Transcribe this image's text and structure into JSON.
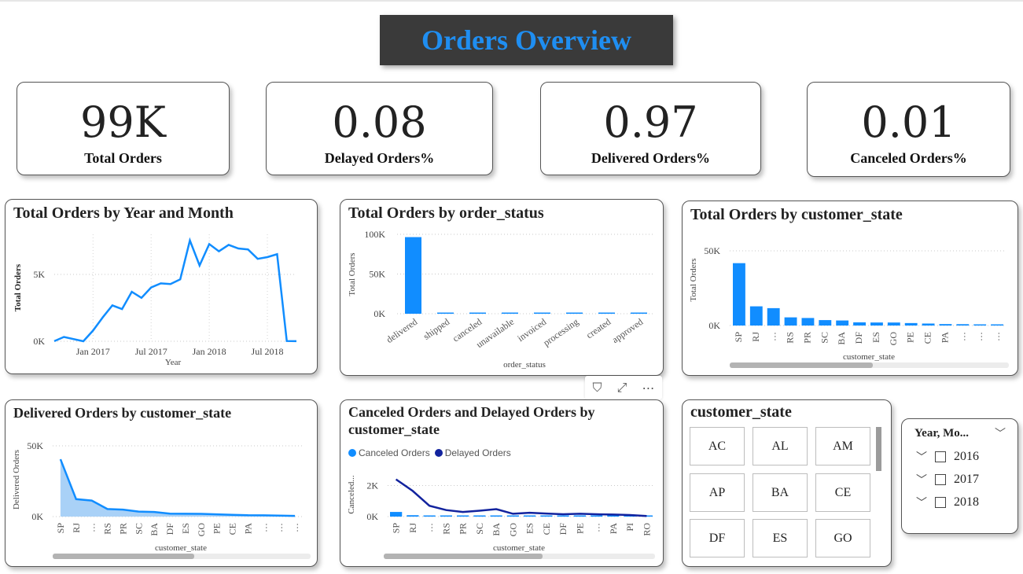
{
  "page": {
    "title": "Orders Overview"
  },
  "kpis": [
    {
      "value": "99K",
      "label": "Total Orders"
    },
    {
      "value": "0.08",
      "label": "Delayed Orders%"
    },
    {
      "value": "0.97",
      "label": "Delivered Orders%"
    },
    {
      "value": "0.01",
      "label": "Canceled Orders%"
    }
  ],
  "colors": {
    "accent": "#118dff",
    "dark_series": "#12239e",
    "area_fill": "#a9d1f7",
    "title_bg": "#3a3a3a"
  },
  "toolbar": {
    "filter_icon": "filter-icon",
    "focus_icon": "focus-mode-icon",
    "more_icon": "more-options-icon"
  },
  "chart_data": [
    {
      "type": "line",
      "title": "Total Orders by Year and Month",
      "xlabel": "Year",
      "ylabel": "Total Orders",
      "x_ticks": [
        "Jan 2017",
        "Jul 2017",
        "Jan 2018",
        "Jul 2018"
      ],
      "y_ticks": [
        "0K",
        "5K"
      ],
      "ylim": [
        0,
        8000
      ],
      "x": [
        "2016-09",
        "2016-10",
        "2016-12",
        "2017-01",
        "2017-02",
        "2017-03",
        "2017-04",
        "2017-05",
        "2017-06",
        "2017-07",
        "2017-08",
        "2017-09",
        "2017-10",
        "2017-11",
        "2017-12",
        "2018-01",
        "2018-02",
        "2018-03",
        "2018-04",
        "2018-05",
        "2018-06",
        "2018-07",
        "2018-08",
        "2018-09",
        "2018-10"
      ],
      "values": [
        4,
        324,
        1,
        800,
        1780,
        2682,
        2404,
        3700,
        3245,
        4026,
        4331,
        4285,
        4631,
        7544,
        5673,
        7269,
        6728,
        7211,
        6939,
        6873,
        6167,
        6292,
        6512,
        16,
        4
      ]
    },
    {
      "type": "bar",
      "title": "Total Orders by order_status",
      "xlabel": "order_status",
      "ylabel": "Total Orders",
      "y_ticks": [
        "0K",
        "50K",
        "100K"
      ],
      "ylim": [
        0,
        100000
      ],
      "categories": [
        "delivered",
        "shipped",
        "canceled",
        "unavailable",
        "invoiced",
        "processing",
        "created",
        "approved"
      ],
      "values": [
        96478,
        1107,
        625,
        609,
        314,
        301,
        5,
        2
      ]
    },
    {
      "type": "bar",
      "title": "Total Orders by customer_state",
      "xlabel": "customer_state",
      "ylabel": "Total Orders",
      "y_ticks": [
        "0K",
        "50K"
      ],
      "ylim": [
        0,
        50000
      ],
      "categories": [
        "SP",
        "RJ",
        "…",
        "RS",
        "PR",
        "SC",
        "BA",
        "DF",
        "ES",
        "GO",
        "PE",
        "CE",
        "PA",
        "…",
        "…",
        "…"
      ],
      "values": [
        41746,
        12852,
        11635,
        5466,
        5045,
        3637,
        3380,
        2140,
        2033,
        2020,
        1652,
        1336,
        975,
        907,
        747,
        536
      ]
    },
    {
      "type": "area",
      "title": "Delivered Orders by customer_state",
      "xlabel": "customer_state",
      "ylabel": "Delivered Orders",
      "y_ticks": [
        "0K",
        "50K"
      ],
      "ylim": [
        0,
        50000
      ],
      "categories": [
        "SP",
        "RJ",
        "…",
        "RS",
        "PR",
        "SC",
        "BA",
        "DF",
        "ES",
        "GO",
        "PE",
        "CE",
        "PA",
        "…",
        "…",
        "…"
      ],
      "values": [
        40501,
        12350,
        11354,
        5345,
        4923,
        3546,
        3256,
        2080,
        1995,
        1957,
        1593,
        1279,
        946,
        887,
        717,
        516
      ]
    },
    {
      "type": "bar+line",
      "title": "Canceled Orders and Delayed Orders by customer_state",
      "xlabel": "customer_state",
      "ylabel": "Canceled...",
      "y_ticks": [
        "0K",
        "2K"
      ],
      "ylim": [
        0,
        4000
      ],
      "categories": [
        "SP",
        "RJ",
        "…",
        "RS",
        "PR",
        "SC",
        "BA",
        "GO",
        "ES",
        "CE",
        "DF",
        "PE",
        "…",
        "PA",
        "PI",
        "RO"
      ],
      "series": [
        {
          "name": "Canceled Orders",
          "type": "bar",
          "values": [
            300,
            90,
            50,
            30,
            25,
            20,
            15,
            12,
            10,
            10,
            8,
            8,
            6,
            5,
            4,
            3
          ]
        },
        {
          "name": "Delayed Orders",
          "type": "line",
          "values": [
            2400,
            1650,
            700,
            420,
            300,
            380,
            480,
            180,
            250,
            200,
            150,
            180,
            150,
            130,
            100,
            40
          ]
        }
      ]
    }
  ],
  "slicer": {
    "title": "customer_state",
    "tiles": [
      "AC",
      "AL",
      "AM",
      "AP",
      "BA",
      "CE",
      "DF",
      "ES",
      "GO"
    ]
  },
  "hierarchy_slicer": {
    "title": "Year, Mo...",
    "items": [
      "2016",
      "2017",
      "2018"
    ]
  }
}
